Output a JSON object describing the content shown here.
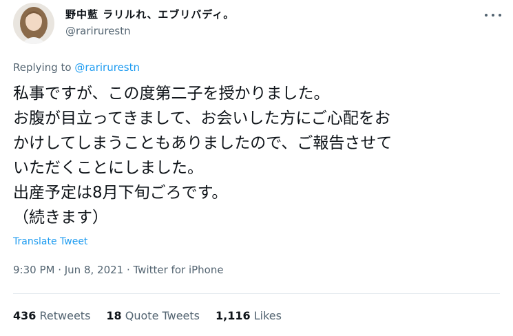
{
  "author": {
    "display_name": "野中藍 ラリルれ、エブリバディ。",
    "handle": "@rarirurestn"
  },
  "reply": {
    "prefix": "Replying to",
    "mention": "@rarirurestn"
  },
  "tweet": {
    "lines": [
      "私事ですが、この度第二子を授かりました。",
      "お腹が目立ってきまして、お会いした方にご心配をお",
      "かけしてしまうこともありましたので、ご報告させて",
      "いただくことにしました。",
      "出産予定は8月下旬ごろです。",
      "（続きます）"
    ],
    "translate_label": "Translate Tweet",
    "timestamp": "9:30 PM · Jun 8, 2021 · Twitter for iPhone"
  },
  "stats": {
    "retweets_count": "436",
    "retweets_label": "Retweets",
    "quotes_count": "18",
    "quotes_label": "Quote Tweets",
    "likes_count": "1,116",
    "likes_label": "Likes"
  },
  "icons": {
    "more": "more-horizontal-icon",
    "avatar": "profile-avatar"
  },
  "colors": {
    "accent": "#1d9bf0",
    "text": "#0f1419",
    "muted": "#536471"
  }
}
